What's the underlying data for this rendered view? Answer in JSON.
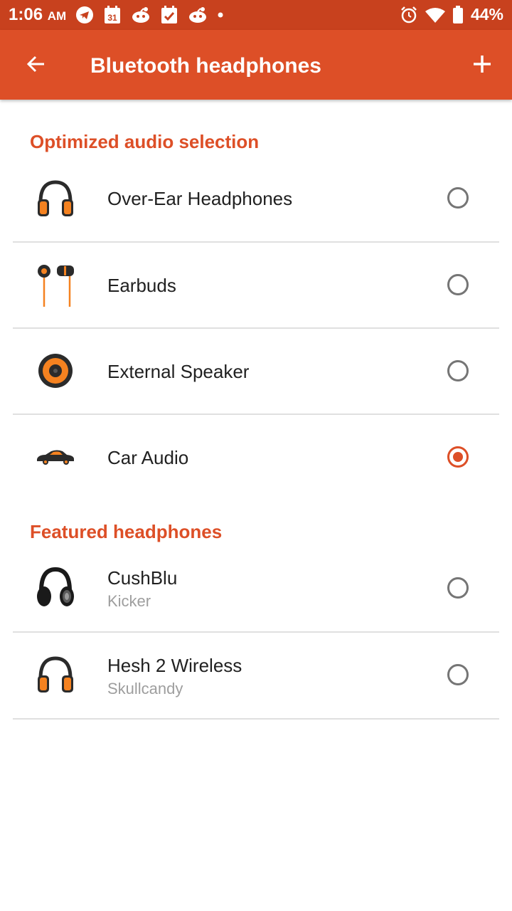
{
  "status_bar": {
    "time": "1:06",
    "ampm": "AM",
    "calendar_day": "31",
    "battery_percent": "44%",
    "notification_icons": [
      "telegram-icon",
      "calendar-icon",
      "reddit-icon",
      "calendar-check-icon",
      "reddit-icon",
      "dot-icon"
    ],
    "system_icons": [
      "alarm-icon",
      "wifi-icon",
      "battery-icon"
    ]
  },
  "app_bar": {
    "title": "Bluetooth headphones",
    "back_icon": "arrow-back-icon",
    "add_icon": "plus-icon",
    "color": "#dd4f27"
  },
  "sections": [
    {
      "header": "Optimized audio selection",
      "items": [
        {
          "label": "Over-Ear Headphones",
          "icon": "headphones-icon",
          "selected": false
        },
        {
          "label": "Earbuds",
          "icon": "earbuds-icon",
          "selected": false
        },
        {
          "label": "External Speaker",
          "icon": "speaker-icon",
          "selected": false
        },
        {
          "label": "Car Audio",
          "icon": "car-icon",
          "selected": true
        }
      ]
    },
    {
      "header": "Featured headphones",
      "items": [
        {
          "label": "CushBlu",
          "sublabel": "Kicker",
          "icon": "cushblu-headphones-icon",
          "selected": false
        },
        {
          "label": "Hesh 2 Wireless",
          "sublabel": "Skullcandy",
          "icon": "headphones-icon",
          "selected": false
        }
      ]
    }
  ],
  "colors": {
    "accent": "#dd4f27",
    "status_bar": "#c8411e",
    "icon_orange": "#f58220",
    "icon_dark": "#2b2b2b"
  }
}
